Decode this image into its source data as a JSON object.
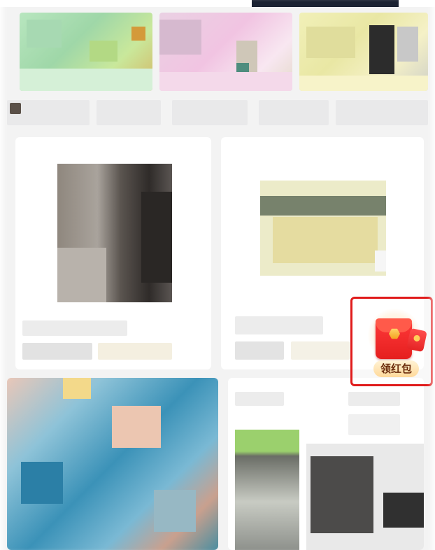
{
  "red_packet": {
    "label": "领红包",
    "icon": "red-envelope-icon",
    "highlight_color": "#e01b1b"
  },
  "colors": {
    "page_background": "#f3f3f3",
    "card_background": "#ffffff",
    "badge_text": "#6b2c0c"
  }
}
